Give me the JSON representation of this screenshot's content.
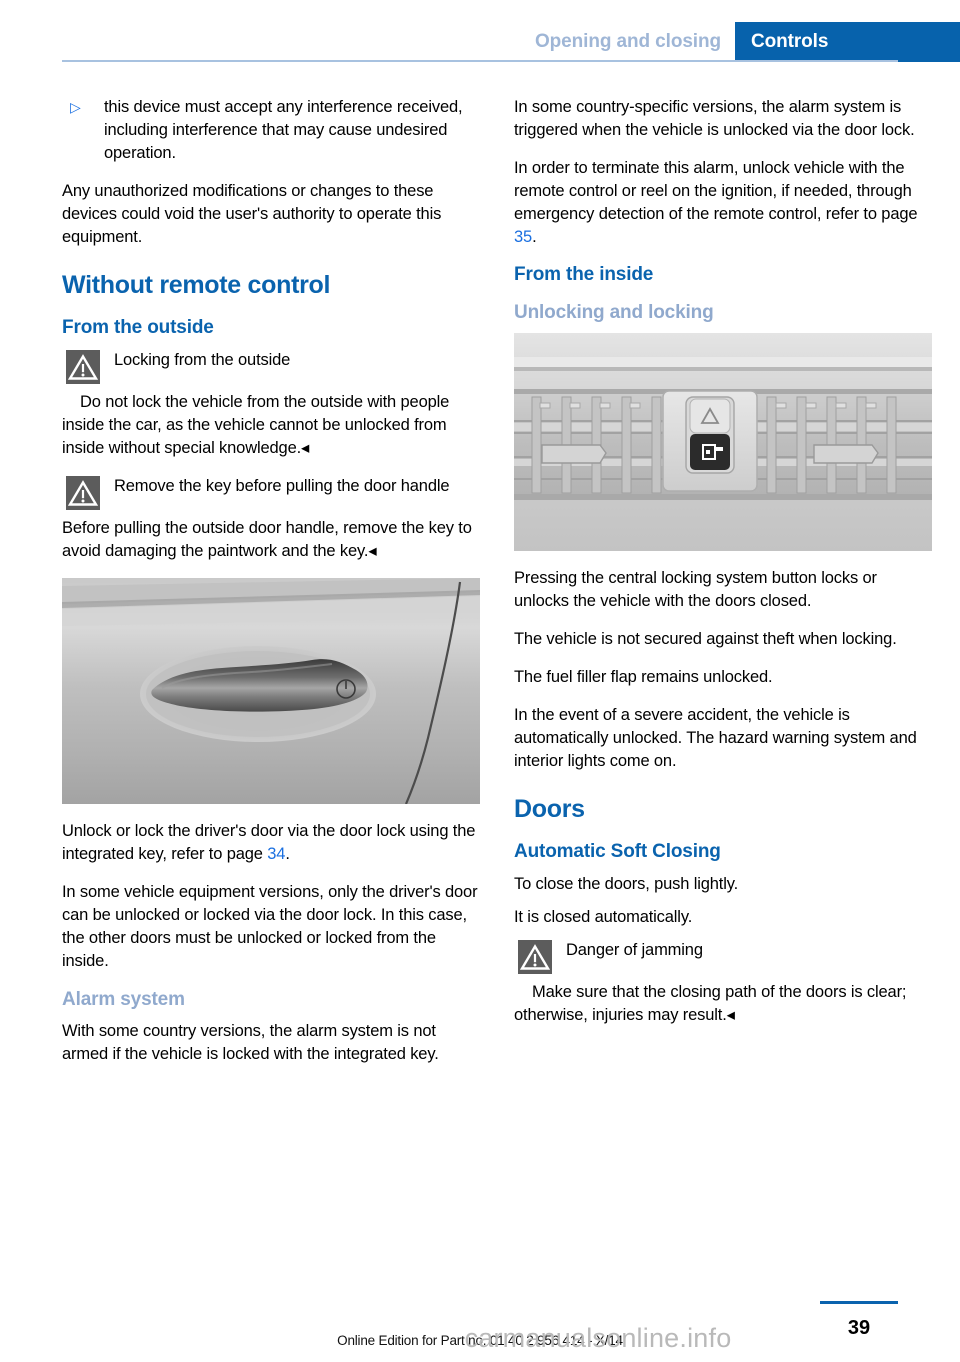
{
  "header": {
    "section_label": "Opening and closing",
    "chapter_label": "Controls"
  },
  "left_column": {
    "bullet": {
      "marker": "▷",
      "text": "this device must accept any interference received, including interference that may cause undesired operation."
    },
    "para_unauthorized": "Any unauthorized modifications or changes to these devices could void the user's authority to operate this equipment.",
    "h1_without_remote": "Without remote control",
    "h2_from_outside": "From the outside",
    "warn1_title": "Locking from the outside",
    "warn1_body": "Do not lock the vehicle from the outside with people inside the car, as the vehicle cannot be unlocked from inside without special knowledge.◂",
    "warn2_title": "Remove the key before pulling the door handle",
    "warn2_body": "Before pulling the outside door handle, remove the key to avoid damaging the paintwork and the key.◂",
    "figure_door_handle_caption": "car-door-handle-illustration",
    "para_unlock_lock_pre": "Unlock or lock the driver's door via the door lock using the integrated key, refer to page ",
    "para_unlock_lock_ref": "34",
    "para_unlock_lock_post": ".",
    "para_equipment_versions": "In some vehicle equipment versions, only the driver's door can be unlocked or locked via the door lock. In this case, the other doors must be unlocked or locked from the inside.",
    "h3_alarm_system": "Alarm system",
    "para_alarm": "With some country versions, the alarm system is not armed if the vehicle is locked with the integrated key."
  },
  "right_column": {
    "para_country_specific": "In some country-specific versions, the alarm system is triggered when the vehicle is unlocked via the door lock.",
    "para_terminate_pre": "In order to terminate this alarm, unlock vehicle with the remote control or reel on the ignition, if needed, through emergency detection of the remote control, refer to page ",
    "para_terminate_ref": "35",
    "para_terminate_post": ".",
    "h2_from_inside": "From the inside",
    "h3_unlocking_locking": "Unlocking and locking",
    "figure_console_caption": "center-console-central-locking-button-illustration",
    "para_pressing": "Pressing the central locking system button locks or unlocks the vehicle with the doors closed.",
    "para_not_secured": "The vehicle is not secured against theft when locking.",
    "para_fuel_flap": "The fuel filler flap remains unlocked.",
    "para_severe_accident": "In the event of a severe accident, the vehicle is automatically unlocked. The hazard warning system and interior lights come on.",
    "h1_doors": "Doors",
    "h2_automatic_soft_closing": "Automatic Soft Closing",
    "para_close_doors": "To close the doors, push lightly.",
    "para_closed_automatically": "It is closed automatically.",
    "warn3_title": "Danger of jamming",
    "warn3_body": "Make sure that the closing path of the doors is clear; otherwise, injuries may result.◂"
  },
  "footer": {
    "page_number": "39",
    "edition_line": "Online Edition for Part no. 01 40 2 956 414 - X/14",
    "watermark": "carmanualsonline.info"
  },
  "colors": {
    "chapter_tab_bg": "#0762ac",
    "section_label": "#9fb6d6",
    "heading_blue": "#0a63ae",
    "subheading_light_blue": "#90a9cd",
    "page_ref_blue": "#1a6fe0",
    "rule_blue": "#a8c2e0",
    "warn_icon_bg": "#5c5c5c"
  }
}
